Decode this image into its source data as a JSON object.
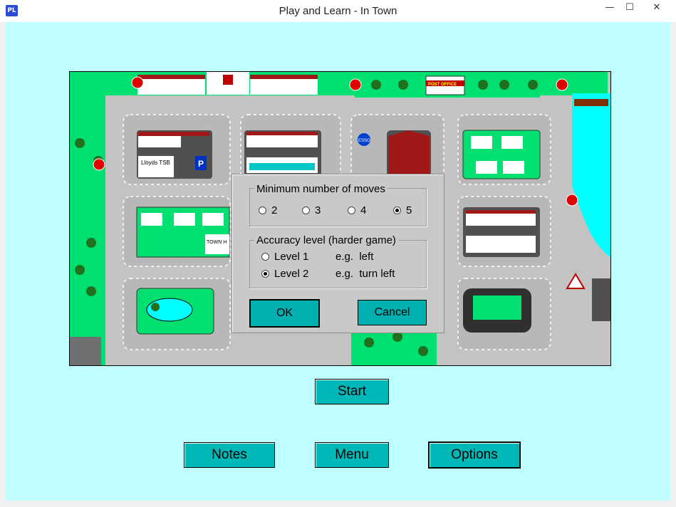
{
  "window": {
    "title": "Play and Learn - In Town",
    "app_icon_text": "PL",
    "minimize_symbol": "—",
    "maximize_symbol": "☐",
    "close_symbol": "✕"
  },
  "map": {
    "bank_sign": "Lloyds TSB",
    "post_office_sign": "POST OFFICE",
    "petrol_sign": "ESSO",
    "town_hall_sign": "TOWN H",
    "parking_sign": "P"
  },
  "dialog": {
    "moves_group_title": "Minimum number of moves",
    "moves_options": [
      {
        "label": "2",
        "checked": false
      },
      {
        "label": "3",
        "checked": false
      },
      {
        "label": "4",
        "checked": false
      },
      {
        "label": "5",
        "checked": true
      }
    ],
    "accuracy_group_title": "Accuracy level (harder game)",
    "accuracy_options": [
      {
        "label": "Level 1",
        "example": "e.g.  left",
        "checked": false
      },
      {
        "label": "Level 2",
        "example": "e.g.  turn left",
        "checked": true
      }
    ],
    "ok_label": "OK",
    "cancel_label": "Cancel"
  },
  "buttons": {
    "start": "Start",
    "notes": "Notes",
    "menu": "Menu",
    "options": "Options"
  },
  "colors": {
    "background": "#c0ffff",
    "button": "#00b8b8",
    "grass": "#00e070",
    "road": "#c3c3c3"
  }
}
